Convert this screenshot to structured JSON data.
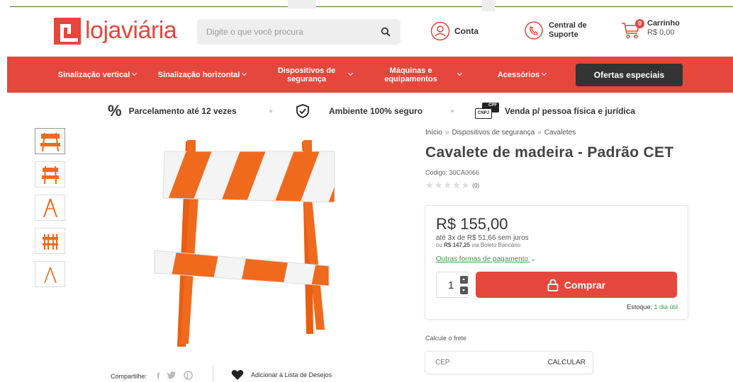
{
  "header": {
    "logo_text": "lojaviária",
    "search_placeholder": "Digite o que você procura",
    "account_label": "Conta",
    "support_label": "Central de Suporte",
    "cart_title": "Carrinho",
    "cart_total": "R$ 0,00",
    "cart_count": "0"
  },
  "nav": {
    "items": [
      {
        "label": "Sinalização vertical"
      },
      {
        "label": "Sinalização horizontal"
      },
      {
        "label": "Dispositivos de segurança"
      },
      {
        "label": "Máquinas e equipamentos"
      },
      {
        "label": "Acessórios"
      }
    ],
    "offers_label": "Ofertas especiais"
  },
  "benefits": [
    {
      "label": "Parcelamento até 12 vezes",
      "icon": "percent-icon"
    },
    {
      "label": "Ambiente 100% seguro",
      "icon": "shield-check-icon"
    },
    {
      "label": "Venda p/ pessoa física e jurídica",
      "icon": "cpf-cnpj-icon",
      "badge_top": "CPF",
      "badge_bottom": "CNPJ"
    }
  ],
  "product": {
    "breadcrumb": [
      "Início",
      "Dispositivos de segurança",
      "Cavaletes"
    ],
    "title": "Cavalete de madeira - Padrão CET",
    "sku": "Código: 30CA0066",
    "rating_count": "(0)",
    "price": "R$ 155,00",
    "installments": "até 3x de R$ 51,66 sem juros",
    "boleto_prefix": "ou",
    "boleto_value": "R$ 147,25",
    "boleto_suffix": "via Boleto Bancário",
    "other_payment": "Outras formas de pagamento",
    "quantity": "1",
    "buy_label": "Comprar",
    "stock_label": "Estoque:",
    "stock_value": "1 dia útil",
    "freight_label": "Calcule o frete",
    "cep_placeholder": "CEP",
    "calc_label": "CALCULAR"
  },
  "share": {
    "label": "Compartilhe:",
    "wishlist_label": "Adicionar à Lista de Desejos"
  },
  "colors": {
    "brand": "#e5473d",
    "dark": "#333333",
    "green": "#3aa14b",
    "orange": "#f06a1d"
  }
}
